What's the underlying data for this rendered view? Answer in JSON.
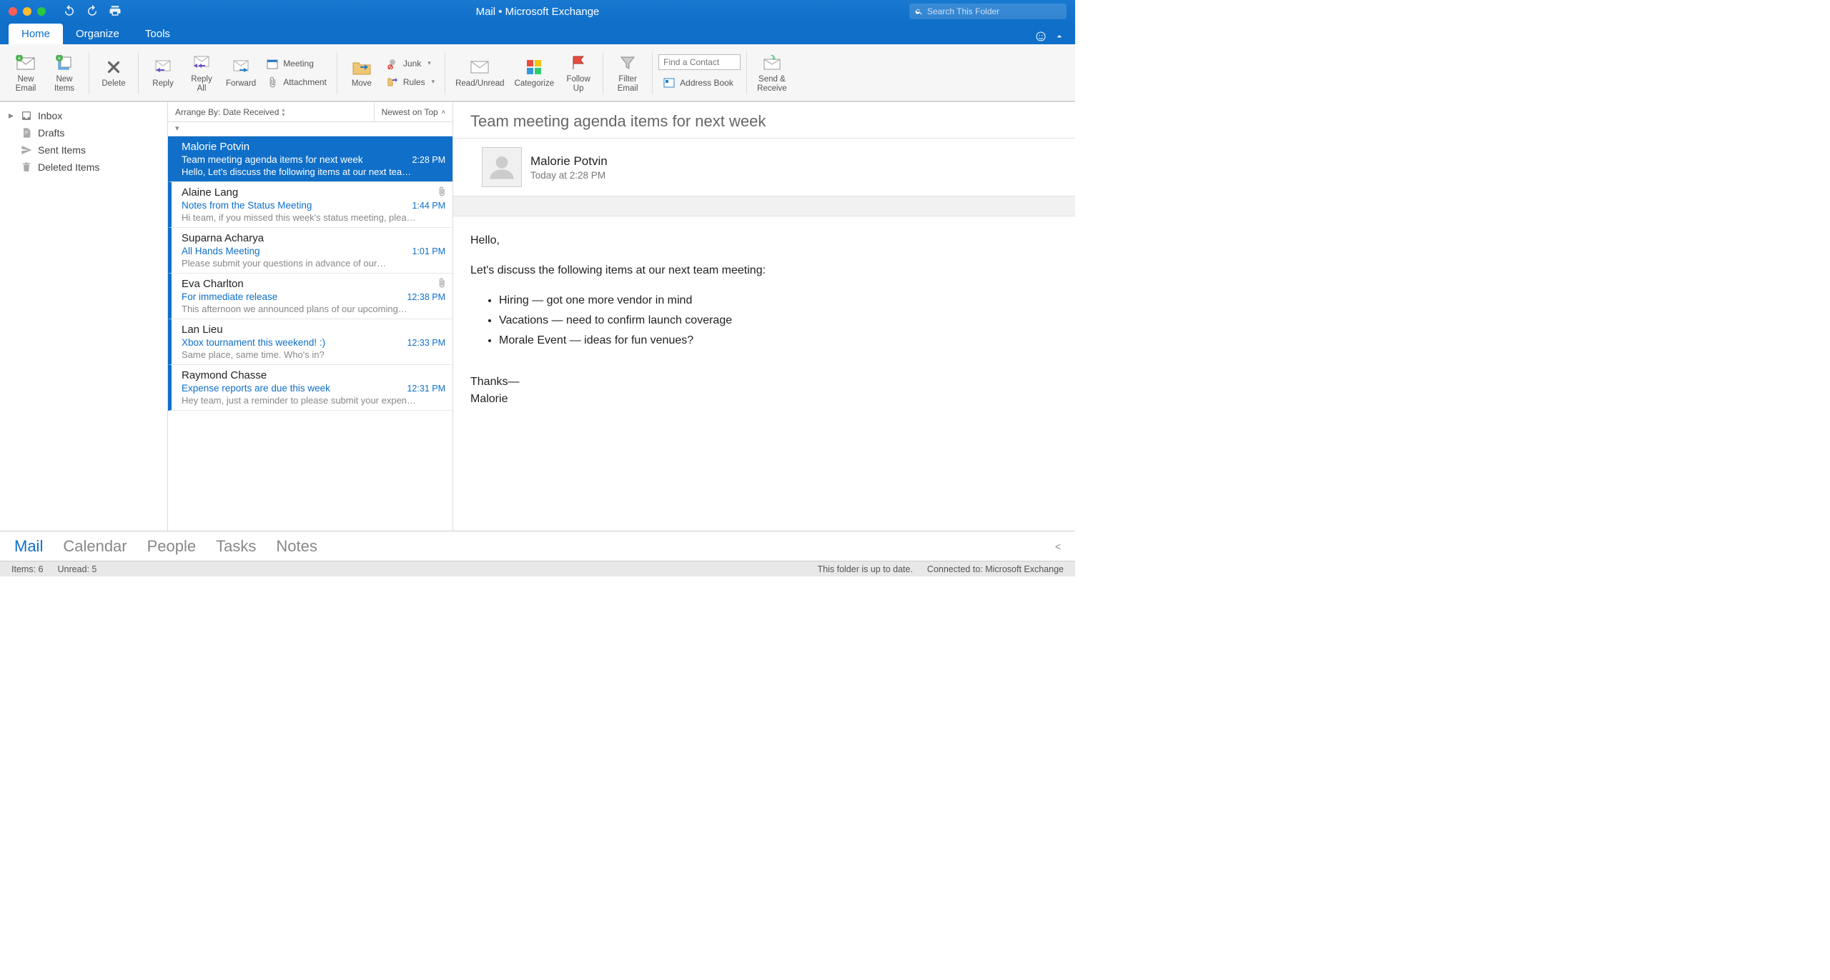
{
  "title": "Mail • Microsoft Exchange",
  "search": {
    "placeholder": "Search This Folder"
  },
  "tabs": {
    "home": "Home",
    "organize": "Organize",
    "tools": "Tools"
  },
  "ribbon": {
    "new_email": "New\nEmail",
    "new_items": "New\nItems",
    "delete": "Delete",
    "reply": "Reply",
    "reply_all": "Reply\nAll",
    "forward": "Forward",
    "meeting": "Meeting",
    "attachment": "Attachment",
    "move": "Move",
    "junk": "Junk",
    "rules": "Rules",
    "read_unread": "Read/Unread",
    "categorize": "Categorize",
    "follow_up": "Follow\nUp",
    "filter_email": "Filter\nEmail",
    "find_contact": "Find a Contact",
    "address_book": "Address Book",
    "send_receive": "Send &\nReceive"
  },
  "folders": {
    "inbox": "Inbox",
    "drafts": "Drafts",
    "sent": "Sent Items",
    "deleted": "Deleted Items"
  },
  "list_header": {
    "arrange": "Arrange By: Date Received",
    "sort": "Newest on Top"
  },
  "messages": [
    {
      "from": "Malorie Potvin",
      "subject": "Team meeting agenda items for next week",
      "time": "2:28 PM",
      "preview": "Hello, Let's discuss the following items at our next tea…",
      "selected": true,
      "attachment": false
    },
    {
      "from": "Alaine Lang",
      "subject": "Notes from the Status Meeting",
      "time": "1:44 PM",
      "preview": "Hi team, if you missed this week's status meeting, plea…",
      "selected": false,
      "attachment": true
    },
    {
      "from": "Suparna Acharya",
      "subject": "All Hands Meeting",
      "time": "1:01 PM",
      "preview": "Please submit your questions in advance of our…",
      "selected": false,
      "attachment": false
    },
    {
      "from": "Eva Charlton",
      "subject": "For immediate release",
      "time": "12:38 PM",
      "preview": "This afternoon we announced plans of our upcoming…",
      "selected": false,
      "attachment": true
    },
    {
      "from": "Lan Lieu",
      "subject": "Xbox tournament this weekend!  :)",
      "time": "12:33 PM",
      "preview": "Same place, same time. Who's in?",
      "selected": false,
      "attachment": false
    },
    {
      "from": "Raymond Chasse",
      "subject": "Expense reports are due this week",
      "time": "12:31 PM",
      "preview": "Hey team, just a reminder to please submit your expen…",
      "selected": false,
      "attachment": false
    }
  ],
  "reading": {
    "subject": "Team meeting agenda items for next week",
    "sender": "Malorie Potvin",
    "when": "Today at 2:28 PM",
    "greeting": "Hello,",
    "intro": "Let's discuss the following items at our next team meeting:",
    "bullets": [
      "Hiring — got one more vendor in mind",
      "Vacations — need to confirm launch coverage",
      "Morale Event — ideas for fun venues?"
    ],
    "sign1": "Thanks—",
    "sign2": "Malorie"
  },
  "nav": {
    "mail": "Mail",
    "calendar": "Calendar",
    "people": "People",
    "tasks": "Tasks",
    "notes": "Notes"
  },
  "status": {
    "items": "Items: 6",
    "unread": "Unread: 5",
    "sync": "This folder is up to date.",
    "conn": "Connected to: Microsoft Exchange"
  }
}
